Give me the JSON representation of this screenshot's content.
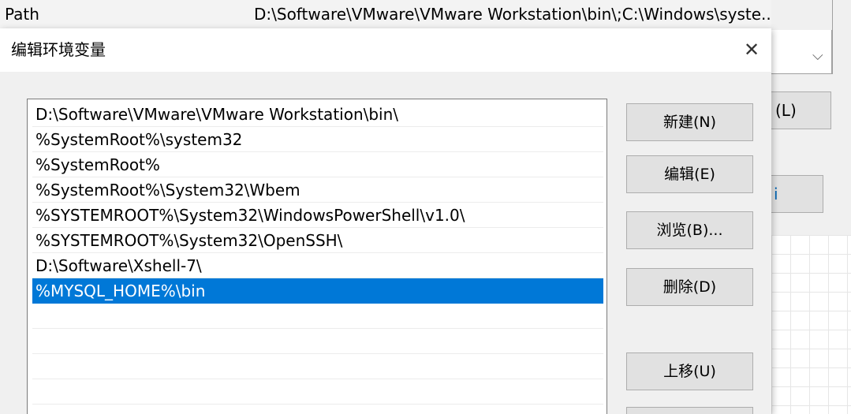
{
  "background_window": {
    "row": {
      "name": "Path",
      "value": "D:\\Software\\VMware\\VMware Workstation\\bin\\;C:\\Windows\\syste..."
    },
    "partial_button_1_label": "(L)",
    "partial_button_2_label": "i",
    "bottom_fragment": "...",
    "combo_arrow": "chevron-down-icon"
  },
  "dialog": {
    "title": "编辑环境变量",
    "close_glyph": "✕",
    "entries": [
      "D:\\Software\\VMware\\VMware Workstation\\bin\\",
      "%SystemRoot%\\system32",
      "%SystemRoot%",
      "%SystemRoot%\\System32\\Wbem",
      "%SYSTEMROOT%\\System32\\WindowsPowerShell\\v1.0\\",
      "%SYSTEMROOT%\\System32\\OpenSSH\\",
      "D:\\Software\\Xshell-7\\",
      "%MYSQL_HOME%\\bin"
    ],
    "selected_index": 7,
    "buttons": {
      "new": "新建(N)",
      "edit": "编辑(E)",
      "browse": "浏览(B)...",
      "delete": "删除(D)",
      "move_up": "上移(U)"
    }
  },
  "colors": {
    "selection": "#0078d7",
    "dialog_bg": "#f0f0f0",
    "button_bg": "#e1e1e1",
    "button_border": "#adadad"
  }
}
